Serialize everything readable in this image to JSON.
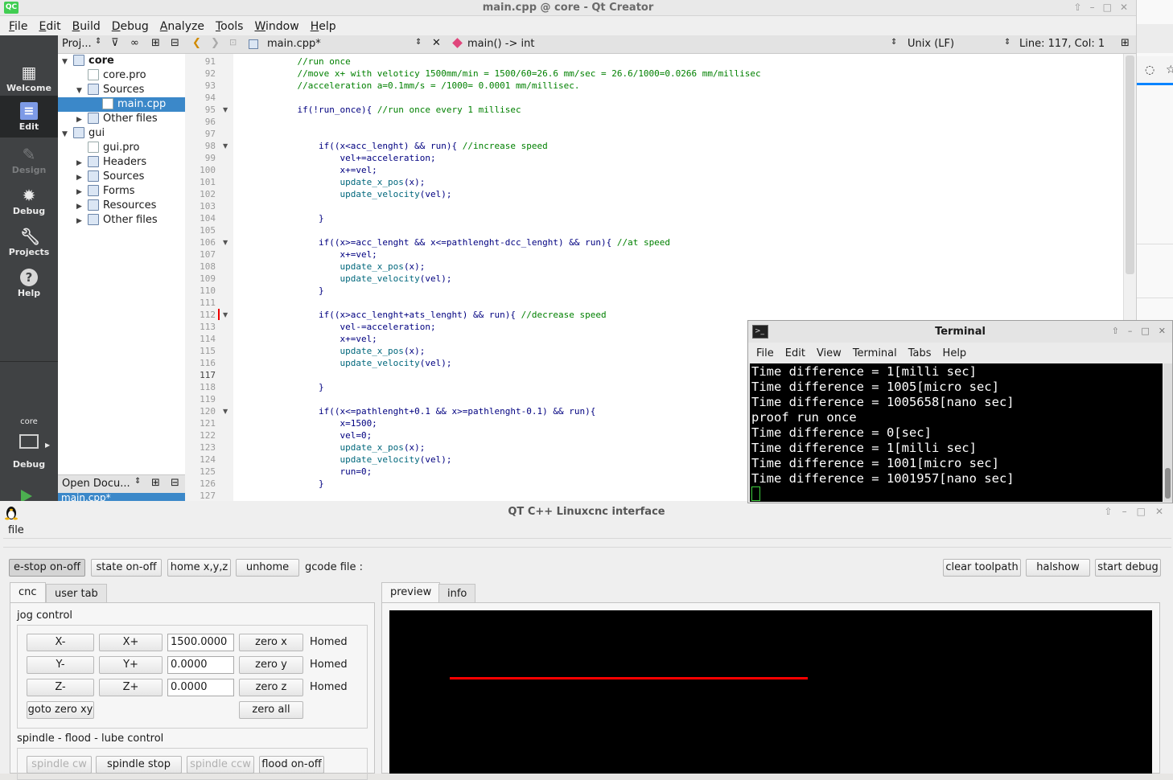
{
  "qtcreator": {
    "title": "main.cpp @ core - Qt Creator",
    "badge": "QC",
    "menu": [
      "File",
      "Edit",
      "Build",
      "Debug",
      "Analyze",
      "Tools",
      "Window",
      "Help"
    ],
    "modes": [
      {
        "label": "Welcome",
        "icon": "welcome-icon",
        "glyph": "▦"
      },
      {
        "label": "Edit",
        "icon": "edit-icon",
        "glyph": "▤"
      },
      {
        "label": "Design",
        "icon": "design-icon",
        "glyph": "✎"
      },
      {
        "label": "Debug",
        "icon": "debug-icon",
        "glyph": "✹"
      },
      {
        "label": "Projects",
        "icon": "projects-icon",
        "glyph": "✦"
      },
      {
        "label": "Help",
        "icon": "help-icon",
        "glyph": "?"
      }
    ],
    "kit": {
      "project": "core",
      "label": "Debug"
    },
    "project_pane": {
      "title": "Proj..."
    },
    "tree": [
      {
        "label": "core",
        "arrow": "▼",
        "indent": 0,
        "bold": true
      },
      {
        "label": "core.pro",
        "arrow": "",
        "indent": 1
      },
      {
        "label": "Sources",
        "arrow": "▼",
        "indent": 1
      },
      {
        "label": "main.cpp",
        "arrow": "",
        "indent": 2,
        "selected": true
      },
      {
        "label": "Other files",
        "arrow": "▶",
        "indent": 1
      },
      {
        "label": "gui",
        "arrow": "▼",
        "indent": 0
      },
      {
        "label": "gui.pro",
        "arrow": "",
        "indent": 1
      },
      {
        "label": "Headers",
        "arrow": "▶",
        "indent": 1
      },
      {
        "label": "Sources",
        "arrow": "▶",
        "indent": 1
      },
      {
        "label": "Forms",
        "arrow": "▶",
        "indent": 1
      },
      {
        "label": "Resources",
        "arrow": "▶",
        "indent": 1
      },
      {
        "label": "Other files",
        "arrow": "▶",
        "indent": 1
      }
    ],
    "open_docs": {
      "title": "Open Docu...",
      "item": "main.cpp*"
    },
    "editor": {
      "file": "main.cpp*",
      "symbol": "main() -> int",
      "line_ending": "Unix (LF)",
      "position": "Line: 117, Col: 1"
    },
    "lines": [
      {
        "n": "91",
        "t": "            //run once",
        "c": "cm"
      },
      {
        "n": "92",
        "t": "            //move x+ with veloticy 1500mm/min = 1500/60=26.6 mm/sec = 26.6/1000=0.0266 mm/millisec",
        "c": "cm"
      },
      {
        "n": "93",
        "t": "            //acceleration a=0.1mm/s = /1000= 0.0001 mm/millisec.",
        "c": "cm"
      },
      {
        "n": "94",
        "t": ""
      },
      {
        "n": "95",
        "t": "            if(!run_once){ //run once every 1 millisec",
        "fold": true
      },
      {
        "n": "96",
        "t": ""
      },
      {
        "n": "97",
        "t": ""
      },
      {
        "n": "98",
        "t": "                if((x<acc_lenght) && run){ //increase speed",
        "fold": true
      },
      {
        "n": "99",
        "t": "                    vel+=acceleration;"
      },
      {
        "n": "100",
        "t": "                    x+=vel;"
      },
      {
        "n": "101",
        "t": "                    update_x_pos(x);",
        "c": "fn"
      },
      {
        "n": "102",
        "t": "                    update_velocity(vel);",
        "c": "fn"
      },
      {
        "n": "103",
        "t": ""
      },
      {
        "n": "104",
        "t": "                }"
      },
      {
        "n": "105",
        "t": ""
      },
      {
        "n": "106",
        "t": "                if((x>=acc_lenght && x<=pathlenght-dcc_lenght) && run){ //at speed",
        "fold": true
      },
      {
        "n": "107",
        "t": "                    x+=vel;"
      },
      {
        "n": "108",
        "t": "                    update_x_pos(x);",
        "c": "fn"
      },
      {
        "n": "109",
        "t": "                    update_velocity(vel);",
        "c": "fn"
      },
      {
        "n": "110",
        "t": "                }"
      },
      {
        "n": "111",
        "t": ""
      },
      {
        "n": "112",
        "t": "                if((x>acc_lenght+ats_lenght) && run){ //decrease speed",
        "fold": true,
        "mark": true
      },
      {
        "n": "113",
        "t": "                    vel-=acceleration;"
      },
      {
        "n": "114",
        "t": "                    x+=vel;"
      },
      {
        "n": "115",
        "t": "                    update_x_pos(x);",
        "c": "fn"
      },
      {
        "n": "116",
        "t": "                    update_velocity(vel);",
        "c": "fn"
      },
      {
        "n": "117",
        "t": "",
        "cur": true
      },
      {
        "n": "118",
        "t": "                }"
      },
      {
        "n": "119",
        "t": ""
      },
      {
        "n": "120",
        "t": "                if((x<=pathlenght+0.1 && x>=pathlenght-0.1) && run){",
        "fold": true
      },
      {
        "n": "121",
        "t": "                    x=1500;"
      },
      {
        "n": "122",
        "t": "                    vel=0;"
      },
      {
        "n": "123",
        "t": "                    update_x_pos(x);",
        "c": "fn"
      },
      {
        "n": "124",
        "t": "                    update_velocity(vel);",
        "c": "fn"
      },
      {
        "n": "125",
        "t": "                    run=0;"
      },
      {
        "n": "126",
        "t": "                }"
      },
      {
        "n": "127",
        "t": ""
      }
    ]
  },
  "terminal": {
    "title": "Terminal",
    "menu": [
      "File",
      "Edit",
      "View",
      "Terminal",
      "Tabs",
      "Help"
    ],
    "lines": [
      "Time difference = 1[milli sec]",
      "Time difference = 1005[micro sec]",
      "Time difference = 1005658[nano sec]",
      "proof run once",
      "Time difference = 0[sec]",
      "Time difference = 1[milli sec]",
      "Time difference = 1001[micro sec]",
      "Time difference = 1001957[nano sec]"
    ]
  },
  "app": {
    "title": "QT C++ Linuxcnc interface",
    "menu_file": "file",
    "toolbar": {
      "estop": "e-stop on-off",
      "state": "state on-off",
      "home": "home x,y,z",
      "unhome": "unhome",
      "gcode_label": "gcode file :",
      "clear": "clear toolpath",
      "halshow": "halshow",
      "debug": "start debug"
    },
    "left_tabs": [
      "cnc",
      "user tab"
    ],
    "right_tabs": [
      "preview",
      "info"
    ],
    "jog": {
      "title": "jog control",
      "rows": [
        {
          "minus": "X-",
          "plus": "X+",
          "value": "1500.0000",
          "zero": "zero x",
          "status": "Homed"
        },
        {
          "minus": "Y-",
          "plus": "Y+",
          "value": "0.0000",
          "zero": "zero y",
          "status": "Homed"
        },
        {
          "minus": "Z-",
          "plus": "Z+",
          "value": "0.0000",
          "zero": "zero z",
          "status": "Homed"
        }
      ],
      "goto_zero": "goto zero xy",
      "zero_all": "zero all"
    },
    "spindle": {
      "title": "spindle - flood - lube control",
      "cw": "spindle cw",
      "stop": "spindle stop",
      "ccw": "spindle ccw",
      "flood": "flood on-off"
    },
    "toolpath_color": "#ff0000"
  }
}
